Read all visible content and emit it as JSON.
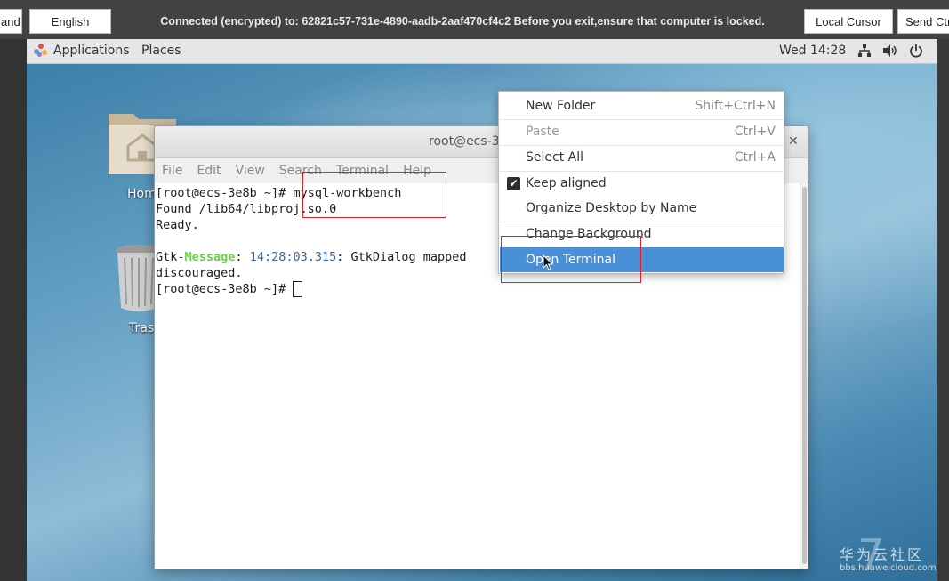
{
  "remote_bar": {
    "left_button": "and",
    "language_button": "English",
    "status": "Connected (encrypted) to: 62821c57-731e-4890-aadb-2aaf470cf4c2 Before you exit,ensure that computer is locked.",
    "local_cursor_button": "Local Cursor",
    "send_button": "Send Ctrl"
  },
  "panel": {
    "applications": "Applications",
    "places": "Places",
    "clock": "Wed 14:28",
    "icons": [
      "network-icon",
      "volume-icon",
      "power-icon"
    ]
  },
  "desktop": {
    "icons": [
      {
        "label": "Hom",
        "icon": "home-folder-icon"
      },
      {
        "label": "Tras",
        "icon": "trash-icon"
      }
    ]
  },
  "terminal": {
    "title": "root@ecs-3",
    "menu": [
      "File",
      "Edit",
      "View",
      "Search",
      "Terminal",
      "Help"
    ],
    "lines": {
      "l1_prompt": "[root@ecs-3e8b ~]# ",
      "l1_cmd": "mysql-workbench",
      "l2": "Found /lib64/libproj.so.0",
      "l3": "Ready.",
      "l5_gtk": "Gtk-",
      "l5_message": "Message",
      "l5_colon": ": ",
      "l5_time": "14:28:03.315",
      "l5_rest": ": GtkDialog mapped",
      "l5_tail": "s",
      "l6": "discouraged.",
      "l7_prompt": "[root@ecs-3e8b ~]# "
    }
  },
  "context_menu": {
    "items": [
      {
        "label": "New Folder",
        "accel": "Shift+Ctrl+N",
        "state": "normal"
      },
      {
        "label": "Paste",
        "accel": "Ctrl+V",
        "state": "disabled"
      },
      {
        "label": "Select All",
        "accel": "Ctrl+A",
        "state": "normal"
      },
      {
        "label": "Keep aligned",
        "accel": "",
        "state": "checked"
      },
      {
        "label": "Organize Desktop by Name",
        "accel": "",
        "state": "normal"
      },
      {
        "label": "Change Background",
        "accel": "",
        "state": "normal"
      },
      {
        "label": "Open Terminal",
        "accel": "",
        "state": "selected"
      }
    ]
  },
  "watermark": {
    "cn": "华为云社区",
    "url": "bbs.huaweicloud.com"
  },
  "colors": {
    "selection": "#4a90d9",
    "annotation": "#e02020",
    "gtk_message": "#6ad14a",
    "timestamp": "#3465a4"
  }
}
